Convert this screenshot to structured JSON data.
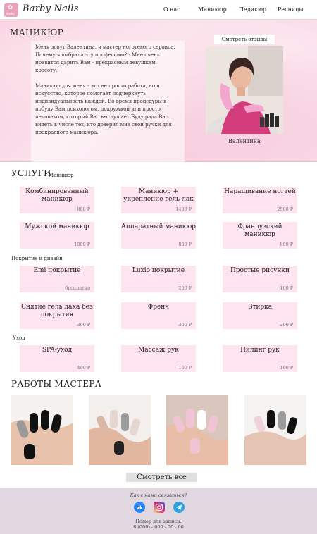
{
  "header": {
    "logo_text": "Barby Nails",
    "logo_badge_text": "Barby",
    "nav": [
      {
        "label": "О нас"
      },
      {
        "label": "Маникюр"
      },
      {
        "label": "Педикюр"
      },
      {
        "label": "Ресницы"
      }
    ]
  },
  "hero": {
    "title": "МАНИКЮР",
    "bio_p1": "Меня зовут Валентина, я мастер ноготевого сервиса. Почему я выбрала эту профессию? - Мне очень нравится дарить Вам - прекрасным девушкам, красоту.",
    "bio_p2": "Маникюр для меня - это не просто работа, но и искусство, которое помогает подчеркнуть индивидуальность каждой. Во время процедуры я побуду Вам психологом, подружкой или просто человеком, который Вас выслушает.Буду рада Вас видеть в числе тех, кто доверил мне свои ручки для прекрасного маникюра.",
    "reviews_button": "Смотреть отзывы",
    "master_name": "Валентина"
  },
  "services": {
    "title": "УСЛУГИ",
    "group1_label": "Маникюр",
    "group2_label": "Покрытие и дизайн",
    "group3_label": "Уход",
    "group1": [
      {
        "name": "Комбинированный маникюр",
        "price": "800 ₽"
      },
      {
        "name": "Маникюр + укрепление гель-лак",
        "price": "1400 ₽"
      },
      {
        "name": "Наращивание ногтей",
        "price": "2500 ₽"
      },
      {
        "name": "Мужской маникюр",
        "price": "1000 ₽"
      },
      {
        "name": "Аппаратный маникюр",
        "price": "800 ₽"
      },
      {
        "name": "Французский маникюр",
        "price": "800 ₽"
      }
    ],
    "group2": [
      {
        "name": "Emi покрытие",
        "price": "бесплатно"
      },
      {
        "name": "Luxio покрытие",
        "price": "200 ₽"
      },
      {
        "name": "Простые рисунки",
        "price": "100 ₽"
      },
      {
        "name": "Снятие гель лака без покрытия",
        "price": "300 ₽"
      },
      {
        "name": "Френч",
        "price": "300 ₽"
      },
      {
        "name": "Втирка",
        "price": "200 ₽"
      }
    ],
    "group3": [
      {
        "name": "SPA-уход",
        "price": "400 ₽"
      },
      {
        "name": "Массаж рук",
        "price": "100 ₽"
      },
      {
        "name": "Пилинг рук",
        "price": "100 ₽"
      }
    ]
  },
  "works": {
    "title": "РАБОТЫ МАСТЕРА",
    "see_all": "Смотреть все"
  },
  "footer": {
    "question": "Как с нами связаться?",
    "socials": [
      {
        "icon": "vk-icon",
        "color": "#2787f5"
      },
      {
        "icon": "instagram-icon",
        "color": "#d62976"
      },
      {
        "icon": "telegram-icon",
        "color": "#2aa3df"
      }
    ],
    "booking_label": "Номер для записи:",
    "phone": "8 (000) - 000 - 00 - 00"
  },
  "colors": {
    "accent_pink": "#fde4ee",
    "footer_bg": "#e0d7e1"
  }
}
